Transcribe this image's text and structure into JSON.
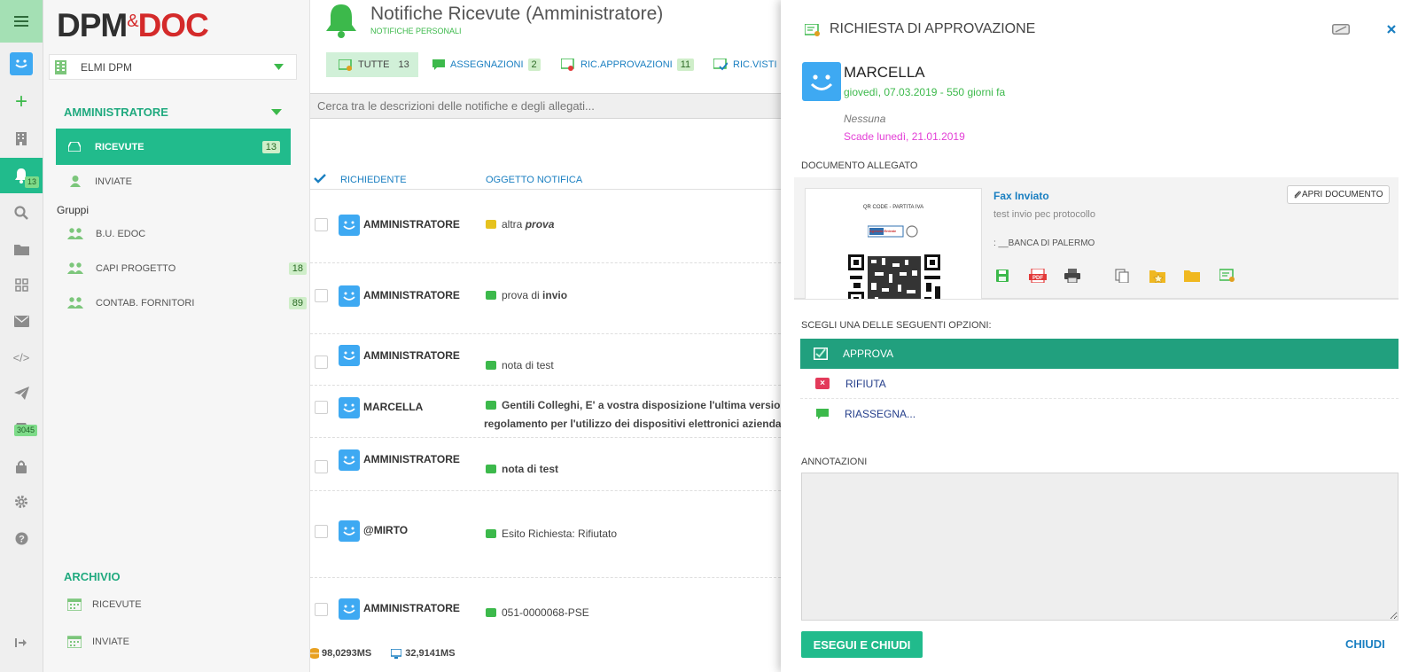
{
  "app": {
    "logo_main": "DPM",
    "logo_amp": "&",
    "logo_doc": "DOC"
  },
  "rail": {
    "notifications_badge": "13",
    "inbox_badge": "3045"
  },
  "nav": {
    "company": "ELMI DPM",
    "role": "AMMINISTRATORE",
    "received": "RICEVUTE",
    "received_count": "13",
    "sent": "INVIATE",
    "groups_title": "Gruppi",
    "groups": [
      {
        "label": "B.U. EDOC",
        "count": ""
      },
      {
        "label": "CAPI PROGETTO",
        "count": "18"
      },
      {
        "label": "CONTAB. FORNITORI",
        "count": "89"
      }
    ],
    "archive_title": "ARCHIVIO",
    "archive_received": "RICEVUTE",
    "archive_sent": "INVIATE"
  },
  "header": {
    "title": "Notifiche Ricevute (Amministratore)",
    "subtitle": "NOTIFICHE PERSONALI"
  },
  "tabs": [
    {
      "label": "TUTTE",
      "count": "13"
    },
    {
      "label": "ASSEGNAZIONI",
      "count": "2"
    },
    {
      "label": "RIC.APPROVAZIONI",
      "count": "11"
    },
    {
      "label": "RIC.VISTI",
      "count": ""
    }
  ],
  "search": {
    "placeholder": "Cerca tra le descrizioni delle notifiche e degli allegati..."
  },
  "table": {
    "col_requester": "RICHIEDENTE",
    "col_subject": "OGGETTO NOTIFICA",
    "rows": [
      {
        "requester": "AMMINISTRATORE",
        "s1": "altra ",
        "s2": "prova",
        "s3": ""
      },
      {
        "requester": "AMMINISTRATORE",
        "s1": "prova di ",
        "s2": "invio",
        "s3": ""
      },
      {
        "requester": "AMMINISTRATORE",
        "s1": "nota di test",
        "s2": "",
        "s3": ""
      },
      {
        "requester": "MARCELLA",
        "s1": "Gentili Colleghi, E' a vostra disposizione l'ultima versione",
        "s2": "",
        "s3": "regolamento per l'utilizzo dei dispositivi elettronici aziendali, v"
      },
      {
        "requester": "AMMINISTRATORE",
        "s1": "nota di test",
        "s2": "",
        "s3": ""
      },
      {
        "requester": "@MIRTO",
        "s1": "Esito Richiesta: Rifiutato",
        "s2": "",
        "s3": ""
      },
      {
        "requester": "AMMINISTRATORE",
        "s1": "051-0000068-PSE",
        "s2": "",
        "s3": ""
      }
    ]
  },
  "footer": {
    "db_time": "98,0293MS",
    "client_time": "32,9141MS"
  },
  "panel": {
    "title": "RICHIESTA DI APPROVAZIONE",
    "user": "MARCELLA",
    "date": "giovedì, 07.03.2019 - 550 giorni fa",
    "note": "Nessuna",
    "due": "Scade lunedì, 21.01.2019",
    "attached_title": "DOCUMENTO ALLEGATO",
    "doc_title": "Fax Inviato",
    "doc_desc": "test invio pec protocollo",
    "doc_meta": ": __BANCA DI PALERMO",
    "open_doc": "APRI DOCUMENTO",
    "thumb_caption": "QR CODE - PARTITA IVA",
    "thumb_logo": "Agenzia Entrate",
    "options_title": "SCEGLI UNA DELLE SEGUENTI OPZIONI:",
    "options": [
      "APPROVA",
      "RIFIUTA",
      "RIASSEGNA..."
    ],
    "annotations_title": "ANNOTAZIONI",
    "submit": "ESEGUI E CHIUDI",
    "close": "CHIUDI"
  },
  "colors": {
    "accent": "#21bb8c",
    "green": "#3cb94b",
    "blue": "#1a7fc1",
    "magenta": "#e33fd6",
    "avatar": "#3ea9f2"
  }
}
